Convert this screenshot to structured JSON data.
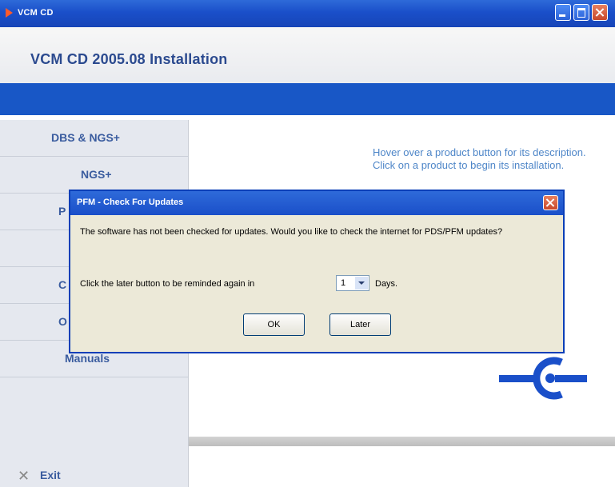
{
  "window": {
    "title": "VCM CD"
  },
  "header": {
    "title": "VCM CD 2005.08 Installation"
  },
  "sidebar": {
    "items": [
      {
        "label": "DBS & NGS+"
      },
      {
        "label": "NGS+"
      },
      {
        "label": "P"
      },
      {
        "label": ""
      },
      {
        "label": "C"
      },
      {
        "label": "O"
      },
      {
        "label": "Manuals"
      }
    ],
    "exit_label": "Exit"
  },
  "content": {
    "hint": "Hover over a product button for its description. Click on a product to begin its installation."
  },
  "dialog": {
    "title": "PFM - Check For Updates",
    "message": "The software has not been checked for updates.  Would you like to check the internet for PDS/PFM updates?",
    "remind_text": "Click the later button to be reminded again in",
    "days_value": "1",
    "days_label": "Days.",
    "ok_label": "OK",
    "later_label": "Later"
  },
  "colors": {
    "titlebar": "#1a4fc9",
    "band": "#1857c6",
    "sidebar_text": "#3a5c9f",
    "hint_text": "#4e86c8"
  },
  "icons": [
    "app-play-icon",
    "minimize-icon",
    "maximize-icon",
    "close-icon",
    "exit-x-icon",
    "ford-logo-icon",
    "dropdown-arrow-icon"
  ]
}
